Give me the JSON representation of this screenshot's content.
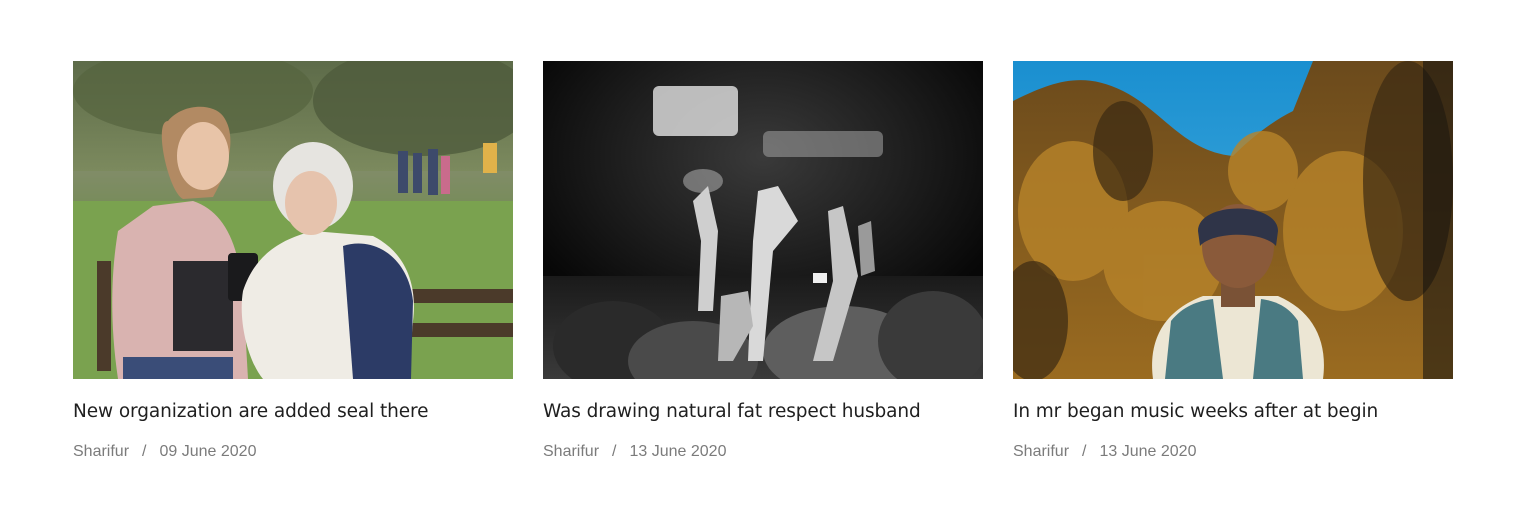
{
  "posts": [
    {
      "image_alt": "young woman showing phone to elderly woman on park bench",
      "title": "New organization are added seal there",
      "author": "Sharifur",
      "separator": "/",
      "date": "09 June 2020"
    },
    {
      "image_alt": "black and white crowd with raised hands",
      "title": "Was drawing natural fat respect husband",
      "author": "Sharifur",
      "separator": "/",
      "date": "13 June 2020"
    },
    {
      "image_alt": "elderly man in beanie and vest in front of autumn forest",
      "title": "In mr began music weeks after at begin",
      "author": "Sharifur",
      "separator": "/",
      "date": "13 June 2020"
    }
  ]
}
